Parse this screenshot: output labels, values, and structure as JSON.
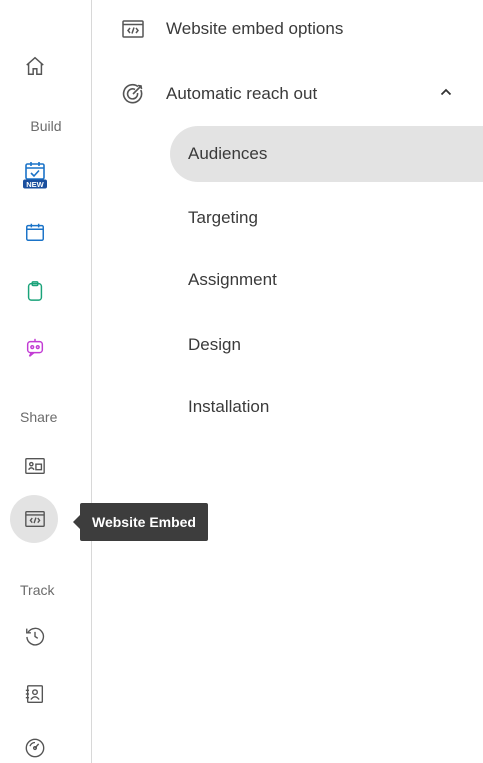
{
  "rail": {
    "sections": {
      "build": "Build",
      "share": "Share",
      "track": "Track"
    },
    "icons": [
      {
        "name": "home-icon"
      },
      {
        "name": "calendar-new-icon",
        "badge": "NEW"
      },
      {
        "name": "calendar-icon"
      },
      {
        "name": "clipboard-icon"
      },
      {
        "name": "bot-icon"
      },
      {
        "name": "contact-card-icon"
      },
      {
        "name": "code-embed-icon"
      },
      {
        "name": "history-icon"
      },
      {
        "name": "contacts-book-icon"
      },
      {
        "name": "gauge-icon"
      }
    ],
    "tooltip": "Website Embed"
  },
  "menu": {
    "website_embed_options": "Website embed options",
    "automatic_reach_out": "Automatic reach out",
    "sub_items": [
      "Audiences",
      "Targeting",
      "Assignment",
      "Design",
      "Installation"
    ],
    "active_sub_index": 0
  },
  "colors": {
    "text": "#3a3a3a",
    "muted": "#6b6b6b",
    "highlight": "#e3e3e3",
    "tooltip_bg": "#3d3d3d",
    "blue": "#1a73c8",
    "teal": "#1aa37a",
    "magenta": "#c23bd4"
  }
}
